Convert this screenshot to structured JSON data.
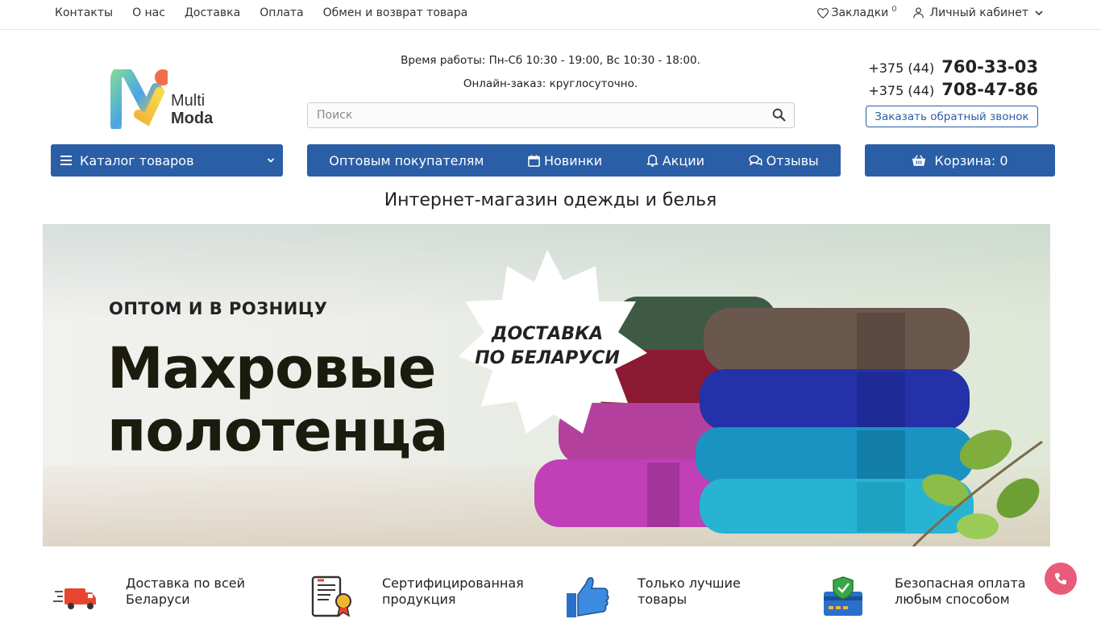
{
  "topnav": {
    "items": [
      "Контакты",
      "О нас",
      "Доставка",
      "Оплата",
      "Обмен и возврат товара"
    ],
    "bookmarks_label": "Закладки",
    "bookmarks_count": "0",
    "account_label": "Личный кабинет"
  },
  "header": {
    "logo_line1": "Multi",
    "logo_line2": "Moda",
    "hours": "Время работы: Пн-Сб 10:30 - 19:00, Вс 10:30 - 18:00.",
    "online": "Онлайн-заказ: круглосуточно.",
    "search_placeholder": "Поиск",
    "phone1_prefix": "+375 (44)",
    "phone1_number": "760-33-03",
    "phone2_prefix": "+375 (44)",
    "phone2_number": "708-47-86",
    "callback_label": "Заказать обратный звонок"
  },
  "nav": {
    "catalog_label": "Каталог товаров",
    "items": [
      "Оптовым покупателям",
      "Новинки",
      "Акции",
      "Отзывы"
    ],
    "cart_label": "Корзина: 0"
  },
  "subtitle": "Интернет-магазин одежды и белья",
  "banner": {
    "small": "ОПТОМ И В РОЗНИЦУ",
    "big_line1": "Махровые",
    "big_line2": "полотенца",
    "star_line1": "ДОСТАВКА",
    "star_line2": "ПО БЕЛАРУСИ"
  },
  "features": [
    {
      "icon": "delivery-truck-icon",
      "line1": "Доставка по всей",
      "line2": "Беларуси"
    },
    {
      "icon": "certificate-icon",
      "line1": "Сертифицированная",
      "line2": "продукция"
    },
    {
      "icon": "thumbs-up-icon",
      "line1": "Только лучшие",
      "line2": "товары"
    },
    {
      "icon": "secure-card-icon",
      "line1": "Безопасная оплата",
      "line2": "любым способом"
    }
  ],
  "colors": {
    "brand_blue": "#2a5ea6",
    "fab_pink": "#e85c7a"
  }
}
